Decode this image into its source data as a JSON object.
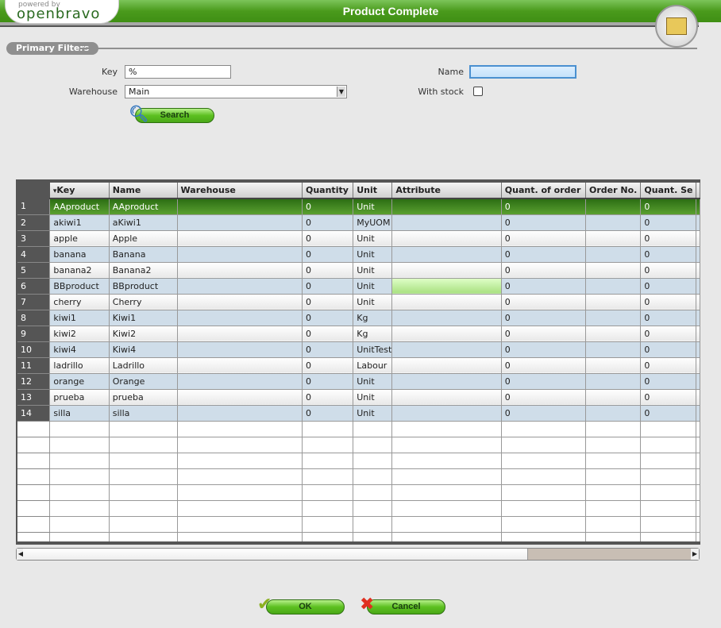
{
  "header": {
    "title": "Product Complete",
    "logo_small": "powered by",
    "logo_text": "openbravo"
  },
  "filters": {
    "section": "Primary Filters",
    "key_label": "Key",
    "key_value": "%",
    "name_label": "Name",
    "name_value": "",
    "warehouse_label": "Warehouse",
    "warehouse_value": "Main",
    "with_stock_label": "With stock",
    "with_stock_checked": false,
    "search_label": "Search"
  },
  "grid": {
    "columns": [
      "Key",
      "Name",
      "Warehouse",
      "Quantity",
      "Unit",
      "Attribute",
      "Quant. of order",
      "Order No.",
      "Quant. Se"
    ],
    "sorted_column": "Key",
    "rows": [
      [
        "1",
        "AAproduct",
        "AAproduct",
        "",
        "0",
        "Unit",
        "",
        "0",
        "",
        "0"
      ],
      [
        "2",
        "akiwi1",
        "aKiwi1",
        "",
        "0",
        "MyUOM",
        "",
        "0",
        "",
        "0"
      ],
      [
        "3",
        "apple",
        "Apple",
        "",
        "0",
        "Unit",
        "",
        "0",
        "",
        "0"
      ],
      [
        "4",
        "banana",
        "Banana",
        "",
        "0",
        "Unit",
        "",
        "0",
        "",
        "0"
      ],
      [
        "5",
        "banana2",
        "Banana2",
        "",
        "0",
        "Unit",
        "",
        "0",
        "",
        "0"
      ],
      [
        "6",
        "BBproduct",
        "BBproduct",
        "",
        "0",
        "Unit",
        "",
        "0",
        "",
        "0"
      ],
      [
        "7",
        "cherry",
        "Cherry",
        "",
        "0",
        "Unit",
        "",
        "0",
        "",
        "0"
      ],
      [
        "8",
        "kiwi1",
        "Kiwi1",
        "",
        "0",
        "Kg",
        "",
        "0",
        "",
        "0"
      ],
      [
        "9",
        "kiwi2",
        "Kiwi2",
        "",
        "0",
        "Kg",
        "",
        "0",
        "",
        "0"
      ],
      [
        "10",
        "kiwi4",
        "Kiwi4",
        "",
        "0",
        "UnitTest",
        "",
        "0",
        "",
        "0"
      ],
      [
        "11",
        "ladrillo",
        "Ladrillo",
        "",
        "0",
        "Labour",
        "",
        "0",
        "",
        "0"
      ],
      [
        "12",
        "orange",
        "Orange",
        "",
        "0",
        "Unit",
        "",
        "0",
        "",
        "0"
      ],
      [
        "13",
        "prueba",
        "prueba",
        "",
        "0",
        "Unit",
        "",
        "0",
        "",
        "0"
      ],
      [
        "14",
        "silla",
        "silla",
        "",
        "0",
        "Unit",
        "",
        "0",
        "",
        "0"
      ]
    ],
    "selected_row": 1
  },
  "footer": {
    "ok_label": "OK",
    "cancel_label": "Cancel"
  },
  "colors": {
    "accent": "#4a9a1c",
    "selected_row": "#2c6e14",
    "alt_row": "#cfdde9"
  }
}
